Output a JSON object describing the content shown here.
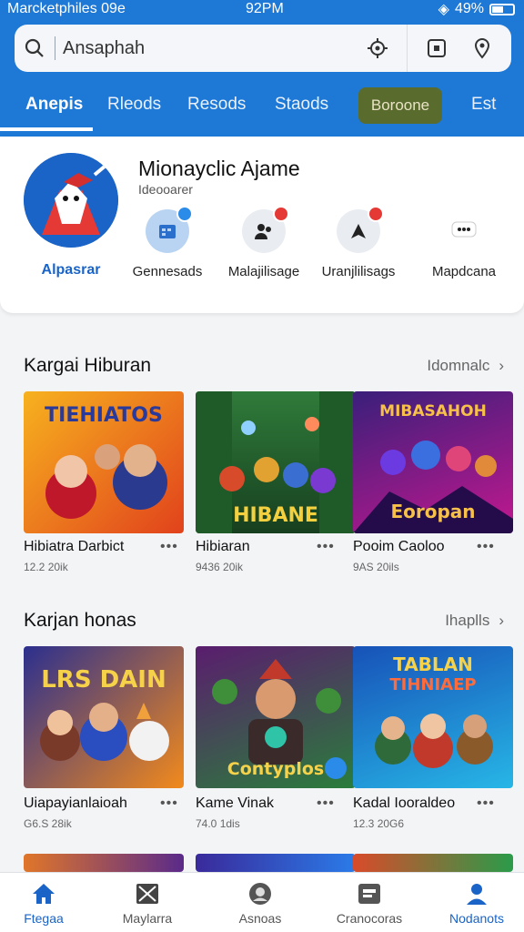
{
  "status": {
    "left": "Marcketphiles 09e",
    "time": "92PM",
    "battery": "49%"
  },
  "search": {
    "value": "Ansaphah"
  },
  "tabs": [
    {
      "label": "Anepis",
      "active": true
    },
    {
      "label": "Rleods"
    },
    {
      "label": "Resods"
    },
    {
      "label": "Staods"
    },
    {
      "label": "Boroone",
      "highlighted": true
    },
    {
      "label": "Est"
    }
  ],
  "profile": {
    "avatar_label": "Alpasrar",
    "title": "Mionayclic Ajame",
    "subtitle": "Ideooarer",
    "actions": [
      {
        "label": "Gennesads",
        "icon": "calendar-icon",
        "badge": "blue"
      },
      {
        "label": "Malajilisage",
        "icon": "people-icon",
        "badge": "red"
      },
      {
        "label": "Uranjlilisags",
        "icon": "edit-icon",
        "badge": "red"
      },
      {
        "label": "Mapdcana",
        "icon": "chat-icon",
        "badge": ""
      }
    ]
  },
  "sections": [
    {
      "title": "Kargai Hiburan",
      "more": "Idomnalc",
      "items": [
        {
          "name": "Hibiatra Darbict",
          "meta": "12.2 20ik",
          "banner": "TIEHIATOS",
          "banner2": "",
          "colors": [
            "#f7b21f",
            "#e1421c"
          ]
        },
        {
          "name": "Hibiaran",
          "meta": "9436 20ik",
          "banner": "HIBANE",
          "banner2": "",
          "colors": [
            "#2f7b3a",
            "#173f1f"
          ]
        },
        {
          "name": "Pooim Caoloo",
          "meta": "9AS 20ils",
          "banner": "MIBASAHOH",
          "banner2": "Eoropan",
          "colors": [
            "#3a1f7a",
            "#c2188f"
          ]
        }
      ]
    },
    {
      "title": "Karjan honas",
      "more": "Ihaplls",
      "items": [
        {
          "name": "Uiapayianlaioah",
          "meta": "G6.S 28ik",
          "banner": "LRS DAIN",
          "banner2": "",
          "colors": [
            "#2b2f8f",
            "#f28a1c"
          ]
        },
        {
          "name": "Kame Vinak",
          "meta": "74.0 1dis",
          "banner": "Contyplos",
          "banner2": "",
          "colors": [
            "#5a1d6e",
            "#2a7d3b"
          ]
        },
        {
          "name": "Kadal Iooraldeo",
          "meta": "12.3 20G6",
          "banner": "TABLAN",
          "banner2": "TIHNIAEP",
          "colors": [
            "#1752b8",
            "#27b6e6"
          ]
        }
      ]
    }
  ],
  "bottom_nav": [
    {
      "label": "Ftegaa",
      "icon": "home-icon",
      "active": true
    },
    {
      "label": "Maylarra",
      "icon": "gallery-icon"
    },
    {
      "label": "Asnoas",
      "icon": "profile-icon"
    },
    {
      "label": "Cranocoras",
      "icon": "briefcase-icon"
    },
    {
      "label": "Nodanots",
      "icon": "user-icon",
      "active": true
    }
  ],
  "colors": {
    "primary": "#1d78d6",
    "accent": "#1a63c7",
    "badge": "#e53935"
  }
}
